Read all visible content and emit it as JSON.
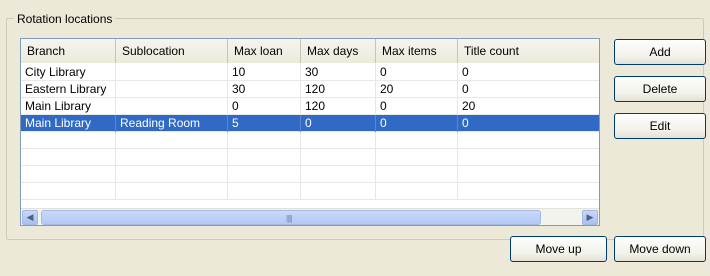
{
  "group": {
    "title": "Rotation locations"
  },
  "table": {
    "columns": [
      "Branch",
      "Sublocation",
      "Max loan",
      "Max days",
      "Max items",
      "Title count"
    ],
    "rows": [
      [
        "City Library",
        "",
        "10",
        "30",
        "0",
        "0"
      ],
      [
        "Eastern Library",
        "",
        "30",
        "120",
        "20",
        "0"
      ],
      [
        "Main Library",
        "",
        "0",
        "120",
        "0",
        "20"
      ],
      [
        "Main Library",
        "Reading Room",
        "5",
        "0",
        "0",
        "0"
      ]
    ],
    "selected_row": 3
  },
  "scrollbar": {
    "grip": "|||||"
  },
  "buttons": {
    "add": "Add",
    "delete": "Delete",
    "edit": "Edit",
    "move_up": "Move up",
    "move_down": "Move down"
  },
  "colors": {
    "selection": "#316ac5",
    "background": "#ece9d8"
  }
}
